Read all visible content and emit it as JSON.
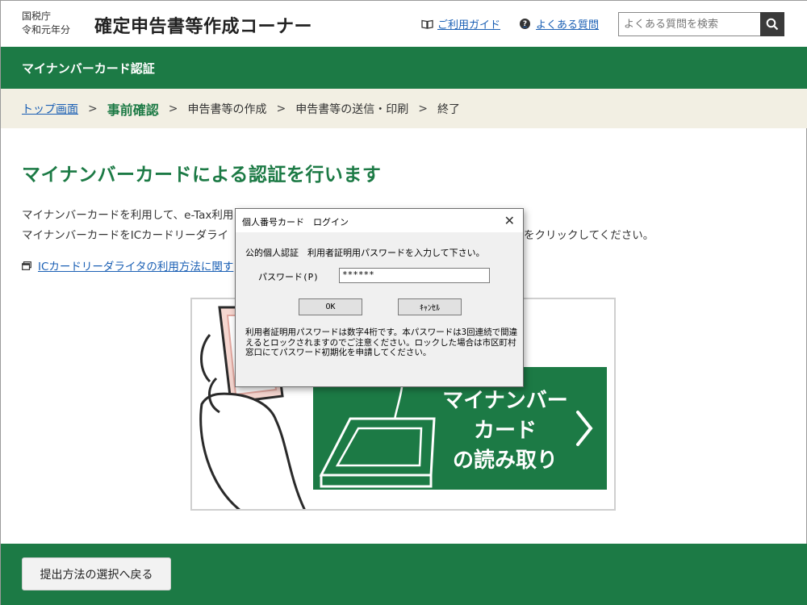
{
  "header": {
    "agency": "国税庁",
    "year": "令和元年分",
    "site_title": "確定申告書等作成コーナー",
    "guide_label": "ご利用ガイド",
    "faq_label": "よくある質問",
    "search_placeholder": "よくある質問を検索"
  },
  "title_bar": {
    "label": "マイナンバーカード認証"
  },
  "breadcrumb": {
    "items": [
      "トップ画面",
      "事前確認",
      "申告書等の作成",
      "申告書等の送信・印刷",
      "終了"
    ]
  },
  "main": {
    "heading": "マイナンバーカードによる認証を行います",
    "para1": "マイナンバーカードを利用して、e-Tax利用",
    "para2": "マイナンバーカードをICカードリーダライ",
    "para2_tail": "をクリックしてください。",
    "reader_link": "ICカードリーダライタの利用方法に関す",
    "reader_button": [
      "マイナンバー",
      "カード",
      "の読み取り"
    ]
  },
  "footer": {
    "back_label": "提出方法の選択へ戻る"
  },
  "dialog": {
    "title": "個人番号カード　ログイン",
    "prompt": "公的個人認証　利用者証明用パスワードを入力して下さい。",
    "password_label": "パスワード(P)",
    "password_value": "******",
    "ok_label": "OK",
    "cancel_label": "ｷｬﾝｾﾙ",
    "note": "利用者証明用パスワードは数字4桁です。本パスワードは3回連続で間違えるとロックされますのでご注意ください。ロックした場合は市区町村窓口にてパスワード初期化を申請してください。"
  },
  "colors": {
    "brand_green": "#1c7a45",
    "link_blue": "#1a5fb4",
    "breadcrumb_bg": "#f2efe3"
  }
}
